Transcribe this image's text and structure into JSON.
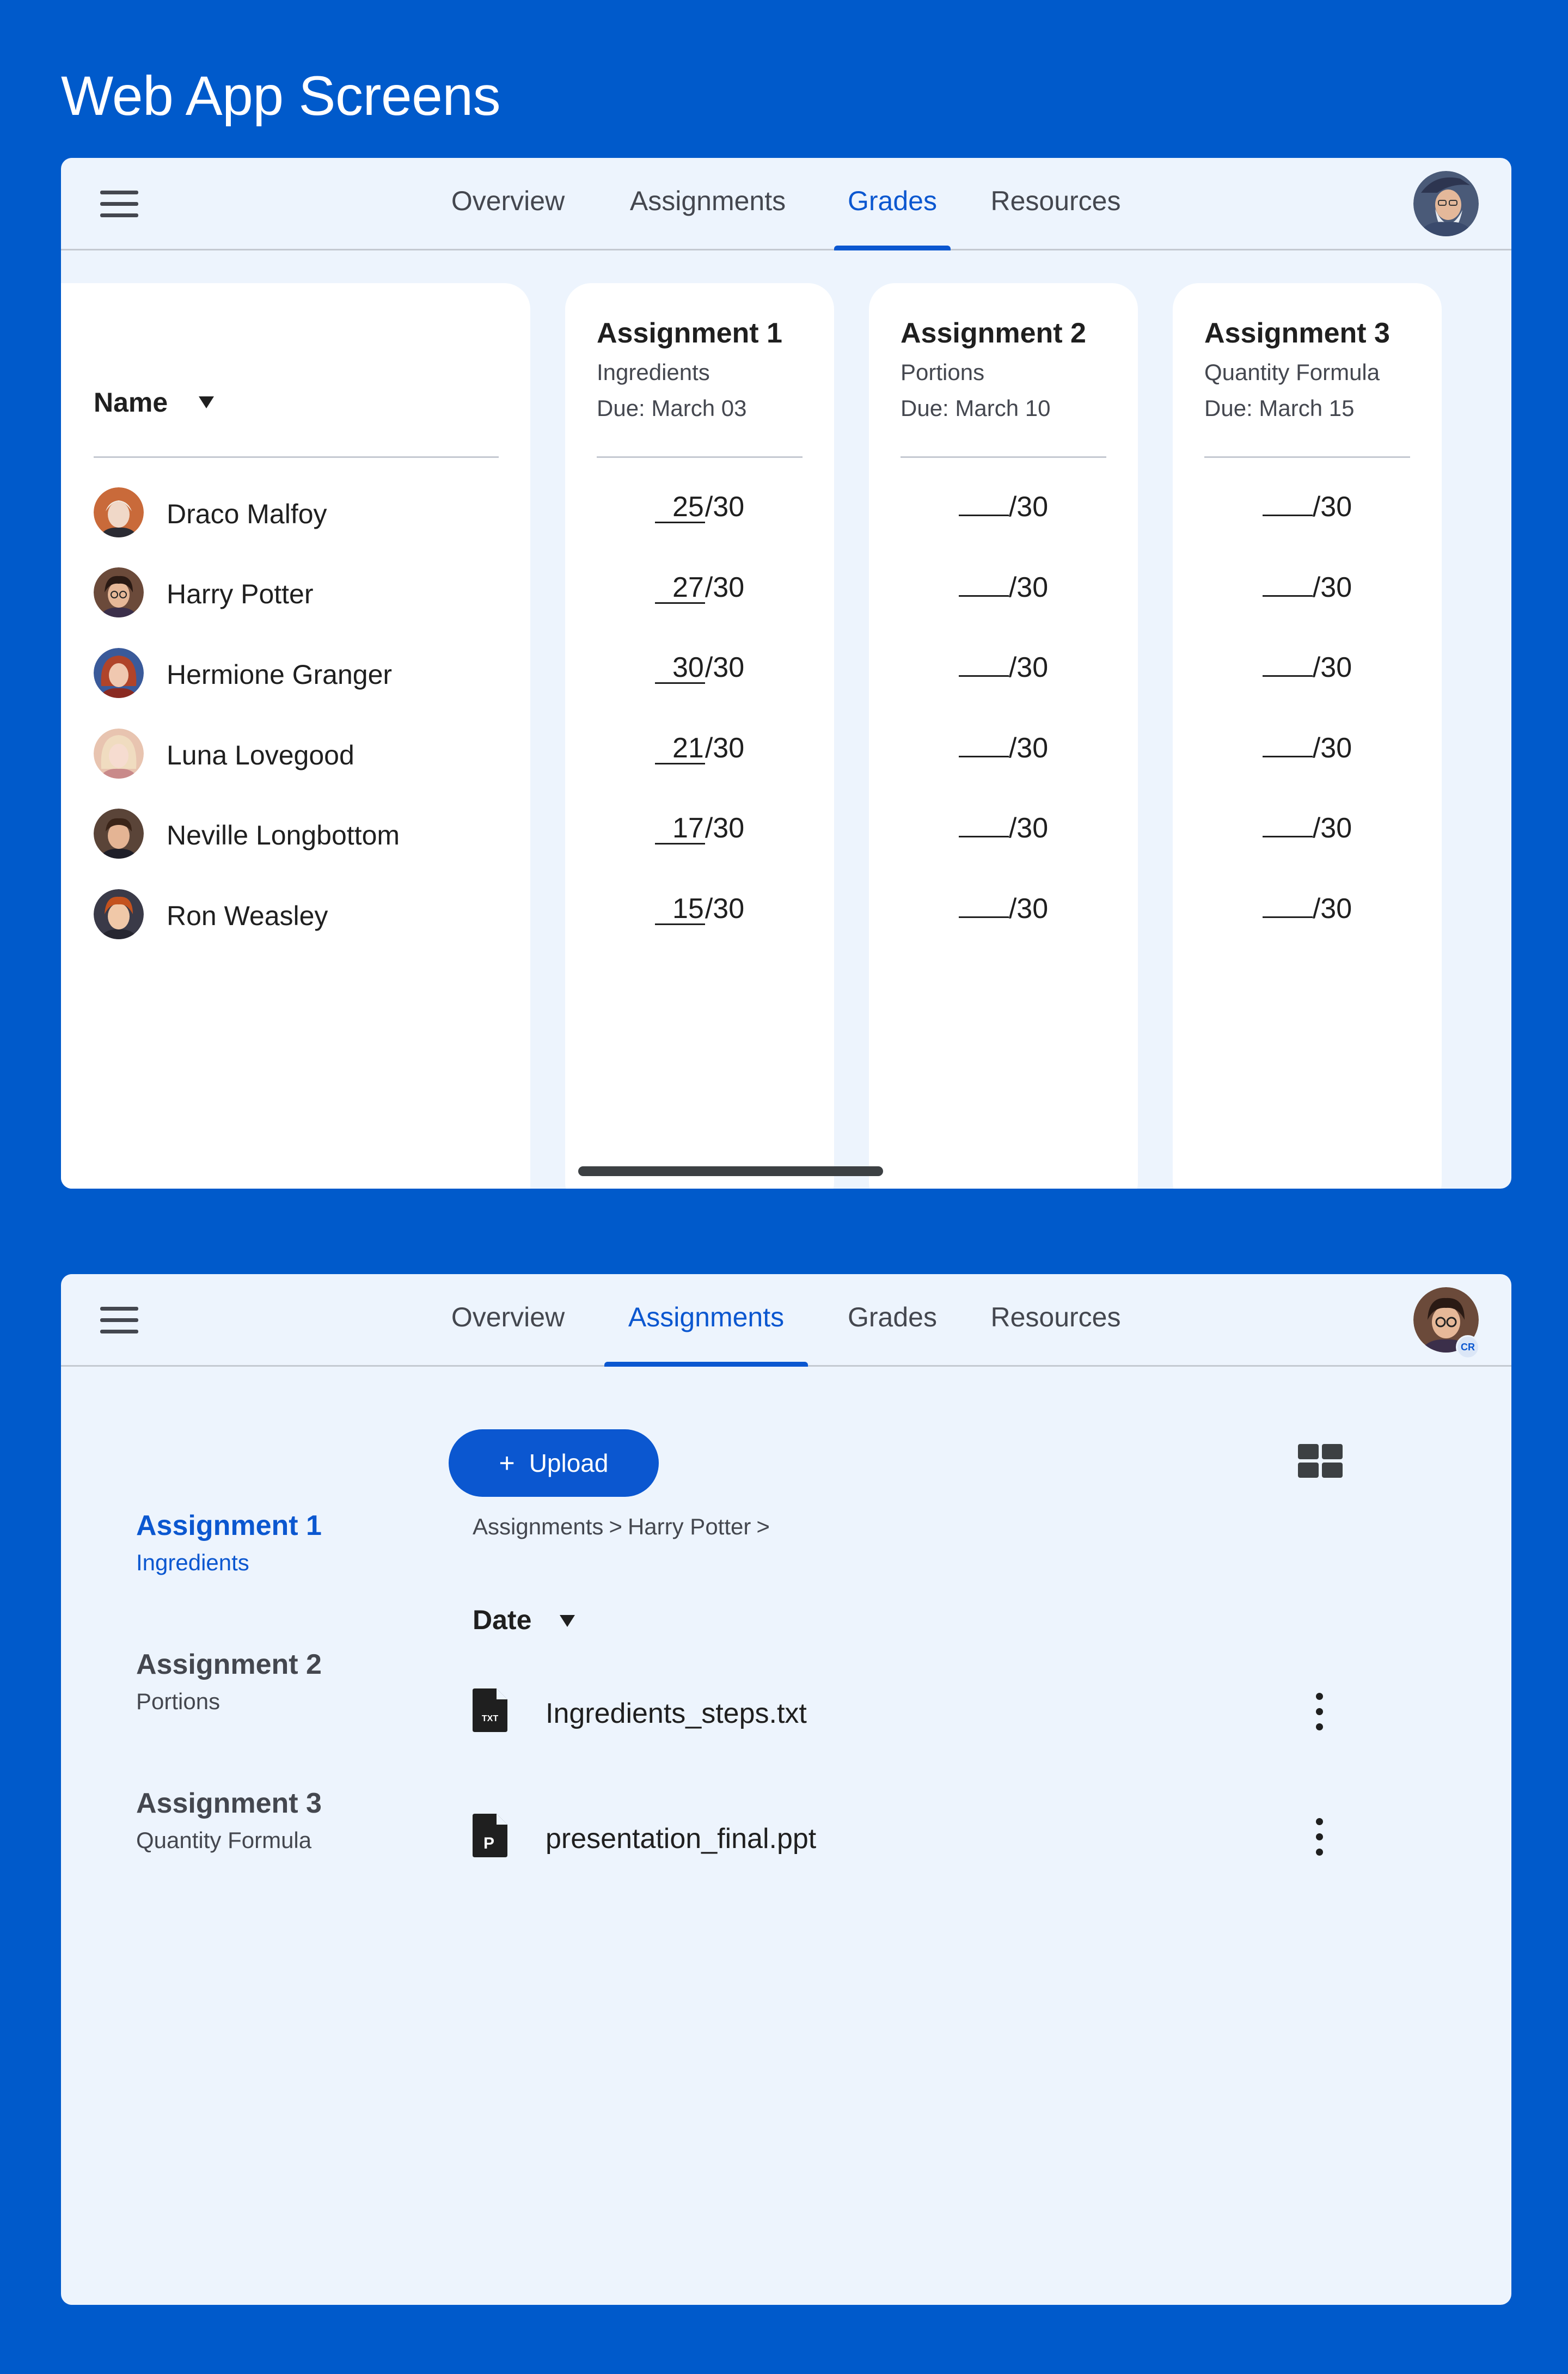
{
  "page_title": "Web App Screens",
  "colors": {
    "background": "#005ACB",
    "accent": "#0B57D0",
    "surface": "#EDF4FD",
    "card": "#FFFFFF"
  },
  "grades_screen": {
    "menu_icon": "hamburger-menu-icon",
    "tabs": [
      {
        "label": "Overview",
        "active": false
      },
      {
        "label": "Assignments",
        "active": false
      },
      {
        "label": "Grades",
        "active": true
      },
      {
        "label": "Resources",
        "active": false
      }
    ],
    "profile_avatar": "wizard-avatar",
    "name_column": {
      "header": "Name",
      "sort_icon": "caret-down-icon"
    },
    "students": [
      {
        "name": "Draco Malfoy",
        "avatar": "draco-avatar"
      },
      {
        "name": "Harry Potter",
        "avatar": "harry-avatar"
      },
      {
        "name": "Hermione Granger",
        "avatar": "hermione-avatar"
      },
      {
        "name": "Luna Lovegood",
        "avatar": "luna-avatar"
      },
      {
        "name": "Neville Longbottom",
        "avatar": "neville-avatar"
      },
      {
        "name": "Ron Weasley",
        "avatar": "ron-avatar"
      }
    ],
    "assignments": [
      {
        "title": "Assignment 1",
        "subtitle": "Ingredients",
        "due": "Due: March 03",
        "grades": [
          {
            "score": "25",
            "max": "/30"
          },
          {
            "score": "27",
            "max": "/30"
          },
          {
            "score": "30",
            "max": "/30"
          },
          {
            "score": "21",
            "max": "/30"
          },
          {
            "score": "17",
            "max": "/30"
          },
          {
            "score": "15",
            "max": "/30"
          }
        ]
      },
      {
        "title": "Assignment 2",
        "subtitle": "Portions",
        "due": "Due: March 10",
        "grades": [
          {
            "score": "",
            "max": "/30"
          },
          {
            "score": "",
            "max": "/30"
          },
          {
            "score": "",
            "max": "/30"
          },
          {
            "score": "",
            "max": "/30"
          },
          {
            "score": "",
            "max": "/30"
          },
          {
            "score": "",
            "max": "/30"
          }
        ]
      },
      {
        "title": "Assignment 3",
        "subtitle": "Quantity Formula",
        "due": "Due: March 15",
        "grades": [
          {
            "score": "",
            "max": "/30"
          },
          {
            "score": "",
            "max": "/30"
          },
          {
            "score": "",
            "max": "/30"
          },
          {
            "score": "",
            "max": "/30"
          },
          {
            "score": "",
            "max": "/30"
          },
          {
            "score": "",
            "max": "/30"
          }
        ]
      }
    ]
  },
  "assignments_screen": {
    "menu_icon": "hamburger-menu-icon",
    "tabs": [
      {
        "label": "Overview",
        "active": false
      },
      {
        "label": "Assignments",
        "active": true
      },
      {
        "label": "Grades",
        "active": false
      },
      {
        "label": "Resources",
        "active": false
      }
    ],
    "profile_avatar": "harry-avatar",
    "profile_badge": "CR",
    "upload_button": {
      "icon": "+",
      "label": "Upload"
    },
    "view_toggle_icon": "grid-view-icon",
    "sidebar": [
      {
        "title": "Assignment 1",
        "subtitle": "Ingredients",
        "active": true
      },
      {
        "title": "Assignment 2",
        "subtitle": "Portions",
        "active": false
      },
      {
        "title": "Assignment 3",
        "subtitle": "Quantity Formula",
        "active": false
      }
    ],
    "breadcrumb": {
      "items": [
        "Assignments",
        "Harry Potter"
      ],
      "separator": ">"
    },
    "files_header": {
      "label": "Date",
      "sort_icon": "caret-down-icon"
    },
    "files": [
      {
        "name": "Ingredients_steps.txt",
        "icon": "txt-file-icon",
        "badge": "TXT",
        "menu_icon": "more-vert-icon"
      },
      {
        "name": "presentation_final.ppt",
        "icon": "ppt-file-icon",
        "badge": "P",
        "menu_icon": "more-vert-icon"
      }
    ]
  }
}
